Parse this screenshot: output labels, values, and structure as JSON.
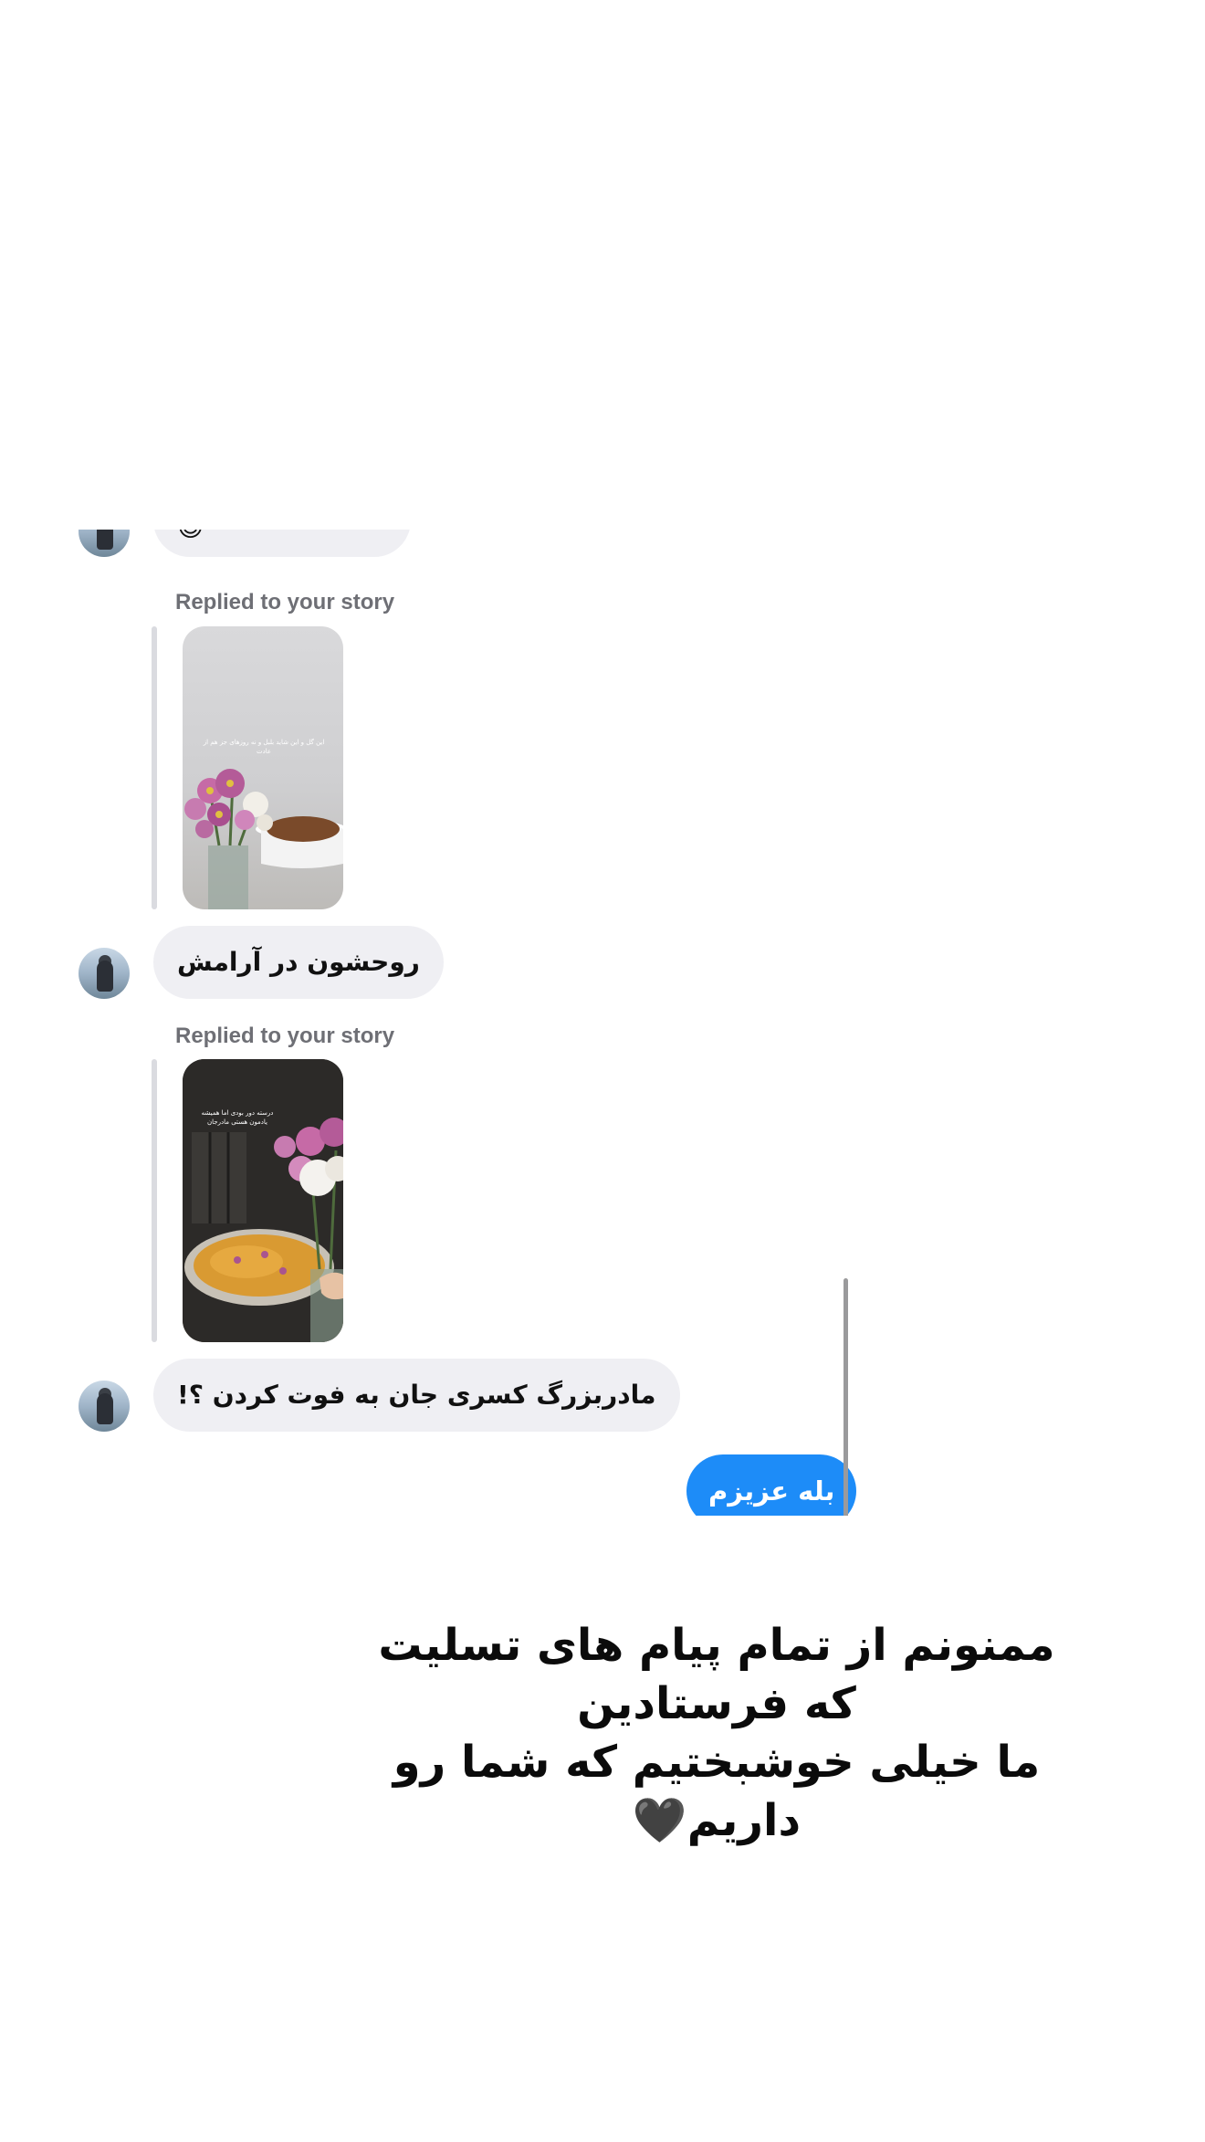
{
  "messages": {
    "top_partial_emoji": "😊",
    "story_reply_1": {
      "label": "Replied to your story",
      "story_caption": "این گل و این شاید بلبل و نه روزهای جز هم از عادت",
      "message": "روحشون در آرامش"
    },
    "story_reply_2": {
      "label": "Replied to your story",
      "story_caption": "درسته دور بودی اما همیشه یادمون هستی مادرجان",
      "message": "مادربزرگ کسری جان به فوت کردن ؟!"
    },
    "my_reply": "بله عزیزم"
  },
  "caption": {
    "line1": "ممنونم از تمام پیام های تسلیت",
    "line2": "که فرستادین",
    "line3": "ما خیلی خوشبختیم که شما رو",
    "line4": "داریم🖤"
  },
  "colors": {
    "incoming_bubble": "#efeff3",
    "outgoing_bubble": "#1d8cf8",
    "label_gray": "#6e6f75"
  }
}
